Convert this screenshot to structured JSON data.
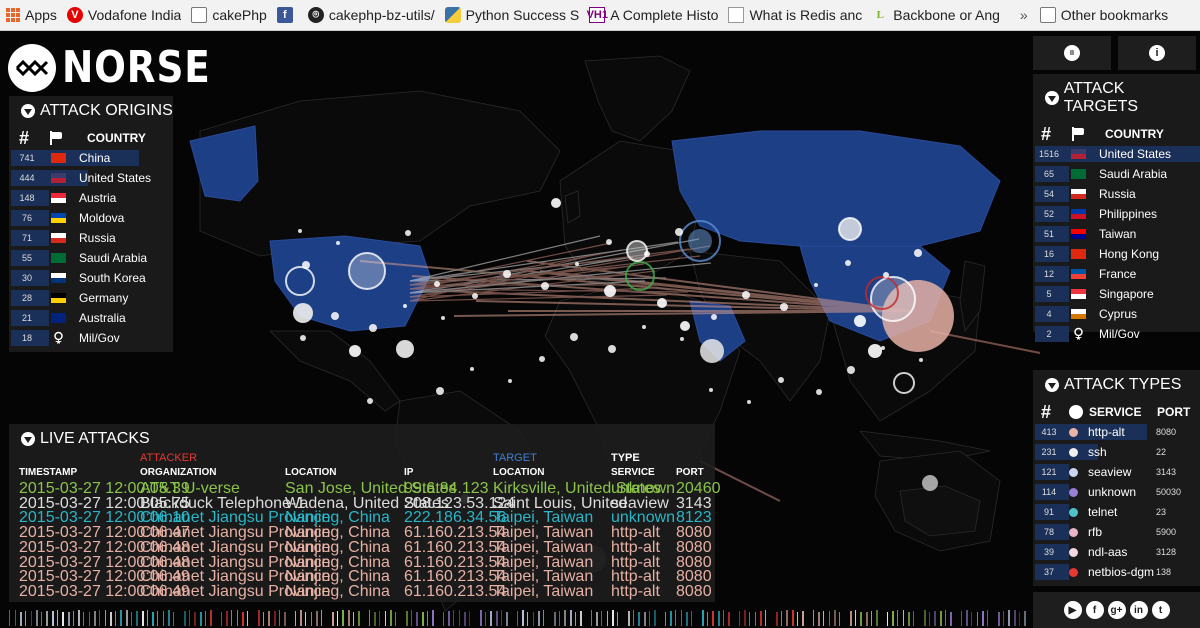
{
  "bookmarks": {
    "items": [
      {
        "id": "apps",
        "label": "Apps",
        "icon": "apps-grid-icon"
      },
      {
        "id": "vodafone",
        "label": "Vodafone India",
        "icon": "vodafone-icon"
      },
      {
        "id": "cakephp",
        "label": "cakePhp",
        "icon": "folder-icon"
      },
      {
        "id": "fb",
        "label": "",
        "icon": "facebook-icon"
      },
      {
        "id": "gh",
        "label": "cakephp-bz-utils/",
        "icon": "github-icon"
      },
      {
        "id": "python",
        "label": "Python Success S",
        "icon": "python-icon"
      },
      {
        "id": "vh1",
        "label": "A Complete Histo",
        "icon": "vh1-icon"
      },
      {
        "id": "redis",
        "label": "What is Redis anc",
        "icon": "document-icon"
      },
      {
        "id": "backbone",
        "label": "Backbone or Ang",
        "icon": "l-icon"
      }
    ],
    "more": "»",
    "other": "Other bookmarks",
    "vodafone_glyph": "V",
    "fb_glyph": "f",
    "gh_glyph": "⌾",
    "vh1_glyph": "VH1",
    "l_glyph": "L"
  },
  "logo": {
    "text": "NORSE"
  },
  "controls": {
    "pause_glyph": "II",
    "info_glyph": "i"
  },
  "origins": {
    "title": "ATTACK ORIGINS",
    "col_num": "#",
    "col_country": "COUNTRY",
    "rows": [
      {
        "count": "741",
        "country": "China",
        "flag": [
          "#de2910",
          "#de2910"
        ],
        "share": 1.0
      },
      {
        "count": "444",
        "country": "United States",
        "flag": [
          "#3c3b6e",
          "#b22234"
        ],
        "share": 0.6
      },
      {
        "count": "148",
        "country": "Austria",
        "flag": [
          "#ed2939",
          "#ffffff"
        ],
        "share": 0.2
      },
      {
        "count": "76",
        "country": "Moldova",
        "flag": [
          "#0046ae",
          "#ffd200"
        ],
        "share": 0.1
      },
      {
        "count": "71",
        "country": "Russia",
        "flag": [
          "#ffffff",
          "#d52b1e"
        ],
        "share": 0.1
      },
      {
        "count": "55",
        "country": "Saudi Arabia",
        "flag": [
          "#006c35",
          "#006c35"
        ],
        "share": 0.07
      },
      {
        "count": "30",
        "country": "South Korea",
        "flag": [
          "#ffffff",
          "#003478"
        ],
        "share": 0.04
      },
      {
        "count": "28",
        "country": "Germany",
        "flag": [
          "#000000",
          "#ffce00"
        ],
        "share": 0.04
      },
      {
        "count": "21",
        "country": "Australia",
        "flag": [
          "#00247d",
          "#00247d"
        ],
        "share": 0.03
      },
      {
        "count": "18",
        "country": "Mil/Gov",
        "flag": [
          "#1e1e1e",
          "#1e1e1e"
        ],
        "share": 0.02
      }
    ]
  },
  "targets": {
    "title": "ATTACK TARGETS",
    "col_num": "#",
    "col_country": "COUNTRY",
    "rows": [
      {
        "count": "1516",
        "country": "United States",
        "flag": [
          "#3c3b6e",
          "#b22234"
        ],
        "share": 1.0
      },
      {
        "count": "65",
        "country": "Saudi Arabia",
        "flag": [
          "#006c35",
          "#006c35"
        ],
        "share": 0.05
      },
      {
        "count": "54",
        "country": "Russia",
        "flag": [
          "#ffffff",
          "#d52b1e"
        ],
        "share": 0.04
      },
      {
        "count": "52",
        "country": "Philippines",
        "flag": [
          "#0038a8",
          "#ce1126"
        ],
        "share": 0.04
      },
      {
        "count": "51",
        "country": "Taiwan",
        "flag": [
          "#fe0000",
          "#000095"
        ],
        "share": 0.04
      },
      {
        "count": "16",
        "country": "Hong Kong",
        "flag": [
          "#de2910",
          "#de2910"
        ],
        "share": 0.02
      },
      {
        "count": "12",
        "country": "France",
        "flag": [
          "#0055a4",
          "#ef4135"
        ],
        "share": 0.01
      },
      {
        "count": "5",
        "country": "Singapore",
        "flag": [
          "#ef3340",
          "#ffffff"
        ],
        "share": 0.01
      },
      {
        "count": "4",
        "country": "Cyprus",
        "flag": [
          "#ffffff",
          "#d57800"
        ],
        "share": 0.01
      },
      {
        "count": "2",
        "country": "Mil/Gov",
        "flag": [
          "#1e1e1e",
          "#1e1e1e"
        ],
        "share": 0.01
      }
    ]
  },
  "types": {
    "title": "ATTACK TYPES",
    "col_num": "#",
    "col_service": "SERVICE",
    "col_port": "PORT",
    "rows": [
      {
        "count": "413",
        "service": "http-alt",
        "port": "8080",
        "color": "#e8b4a8",
        "share": 1.0
      },
      {
        "count": "231",
        "service": "ssh",
        "port": "22",
        "color": "#f0f0f0",
        "share": 0.56
      },
      {
        "count": "121",
        "service": "seaview",
        "port": "3143",
        "color": "#c9d6ec",
        "share": 0.29
      },
      {
        "count": "114",
        "service": "unknown",
        "port": "50030",
        "color": "#9b7fd4",
        "share": 0.28
      },
      {
        "count": "91",
        "service": "telnet",
        "port": "23",
        "color": "#4fc3c8",
        "share": 0.22
      },
      {
        "count": "78",
        "service": "rfb",
        "port": "5900",
        "color": "#e8b4c8",
        "share": 0.19
      },
      {
        "count": "39",
        "service": "ndl-aas",
        "port": "3128",
        "color": "#f0d8e0",
        "share": 0.09
      },
      {
        "count": "37",
        "service": "netbios-dgm",
        "port": "138",
        "color": "#e53935",
        "share": 0.09
      }
    ]
  },
  "live": {
    "title": "LIVE ATTACKS",
    "group_attacker": "ATTACKER",
    "group_target": "TARGET",
    "group_type": "TYPE",
    "attacker_color": "#e53935",
    "target_color": "#3f7fd0",
    "headers": {
      "timestamp": "TIMESTAMP",
      "org": "ORGANIZATION",
      "loc": "LOCATION",
      "ip": "IP",
      "tloc": "LOCATION",
      "service": "SERVICE",
      "port": "PORT"
    },
    "rows": [
      {
        "ts": "2015-03-27  12:00:05.39",
        "org": "AT&T U-verse",
        "loc": "San Jose, United States",
        "ip": "99.6.84.123",
        "tloc": "Kirksville, United States",
        "service": "unknown",
        "port": "20460",
        "color": "#8bc34a"
      },
      {
        "ts": "2015-03-27  12:00:05.75",
        "org": "Blackduck Telephone-1",
        "loc": "Wadena, United States",
        "ip": "208.123.53.124",
        "tloc": "Saint Louis, United",
        "service": "seaview",
        "port": "3143",
        "color": "#dddddd"
      },
      {
        "ts": "2015-03-27  12:00:06.10",
        "org": "Chinanet Jiangsu Province",
        "loc": "Nanjing, China",
        "ip": "222.186.34.56",
        "tloc": "Taipei, Taiwan",
        "service": "unknown",
        "port": "8123",
        "color": "#29b6c8"
      },
      {
        "ts": "2015-03-27  12:00:06.47",
        "org": "Chinanet Jiangsu Province",
        "loc": "Nanjing, China",
        "ip": "61.160.213.54",
        "tloc": "Taipei, Taiwan",
        "service": "http-alt",
        "port": "8080",
        "color": "#e6b0a4"
      },
      {
        "ts": "2015-03-27  12:00:06.48",
        "org": "Chinanet Jiangsu Province",
        "loc": "Nanjing, China",
        "ip": "61.160.213.54",
        "tloc": "Taipei, Taiwan",
        "service": "http-alt",
        "port": "8080",
        "color": "#e6b0a4"
      },
      {
        "ts": "2015-03-27  12:00:06.48",
        "org": "Chinanet Jiangsu Province",
        "loc": "Nanjing, China",
        "ip": "61.160.213.54",
        "tloc": "Taipei, Taiwan",
        "service": "http-alt",
        "port": "8080",
        "color": "#e6b0a4"
      },
      {
        "ts": "2015-03-27  12:00:06.49",
        "org": "Chinanet Jiangsu Province",
        "loc": "Nanjing, China",
        "ip": "61.160.213.54",
        "tloc": "Taipei, Taiwan",
        "service": "http-alt",
        "port": "8080",
        "color": "#e6b0a4"
      },
      {
        "ts": "2015-03-27  12:00:06.49",
        "org": "Chinanet Jiangsu Province",
        "loc": "Nanjing, China",
        "ip": "61.160.213.54",
        "tloc": "Taipei, Taiwan",
        "service": "http-alt",
        "port": "8080",
        "color": "#e6b0a4"
      }
    ]
  },
  "social": [
    {
      "icon": "youtube-icon",
      "glyph": "▶"
    },
    {
      "icon": "facebook-icon",
      "glyph": "f"
    },
    {
      "icon": "google-plus-icon",
      "glyph": "g+"
    },
    {
      "icon": "linkedin-icon",
      "glyph": "in"
    },
    {
      "icon": "twitter-icon",
      "glyph": "t"
    }
  ],
  "colors": {
    "map_land": "#0a0a0a",
    "map_highlight": "#1d3f86",
    "bar": "#1b3058",
    "panel_bg": "#1e1e1e"
  }
}
